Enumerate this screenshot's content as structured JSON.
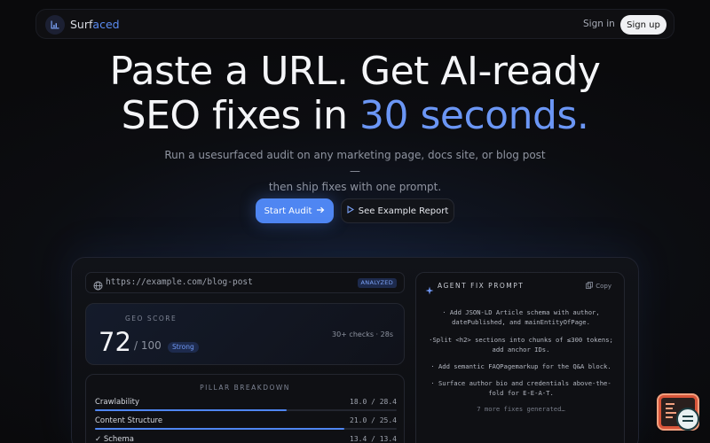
{
  "nav": {
    "brand_prefix": "Surf",
    "brand_accent": "aced",
    "signin": "Sign in",
    "signup": "Sign up"
  },
  "hero": {
    "headline_line1": "Paste a URL. Get AI-ready",
    "headline_line2_prefix": "SEO fixes in ",
    "headline_line2_accent": "30 seconds.",
    "subtitle_line1": "Run a usesurfaced audit on any marketing page, docs site, or blog post —",
    "subtitle_line2": "then ship fixes with one prompt.",
    "primary_cta": "Start Audit",
    "primary_cta_icon": "arrow-right-icon",
    "secondary_cta": "See Example Report",
    "secondary_cta_icon": "play-icon"
  },
  "preview": {
    "url": "https://example.com/blog-post",
    "url_badge": "ANALYZED",
    "geo": {
      "label": "GEO SCORE",
      "value": "72",
      "max": "/ 100",
      "badge": "Strong",
      "checks": "30+ checks · 28s"
    },
    "pillars": {
      "title": "PILLAR BREAKDOWN",
      "items": [
        {
          "name": "Crawlability",
          "score": "18.0 / 28.4",
          "fraction": 0.634
        },
        {
          "name": "Content Structure",
          "score": "21.0 / 25.4",
          "fraction": 0.827
        },
        {
          "name": "✓ Schema",
          "score": "13.4 / 13.4",
          "fraction": 1.0
        }
      ]
    },
    "fix_prompt": {
      "title": "AGENT FIX PROMPT",
      "copy": "Copy",
      "items": [
        "· Add JSON-LD Article schema with author, datePublished, and mainEntityOfPage.",
        "·Split <h2> sections into chunks of ≤300 tokens; add anchor IDs.",
        "· Add semantic FAQPagemarkup for the Q&A block.",
        "· Surface author bio and credentials above-the-fold for E-E-A-T."
      ],
      "more": "7 more fixes generated…"
    }
  },
  "colors": {
    "accent": "#5b8cf2",
    "background": "#0b0c0f",
    "widget": "#d8553a"
  }
}
